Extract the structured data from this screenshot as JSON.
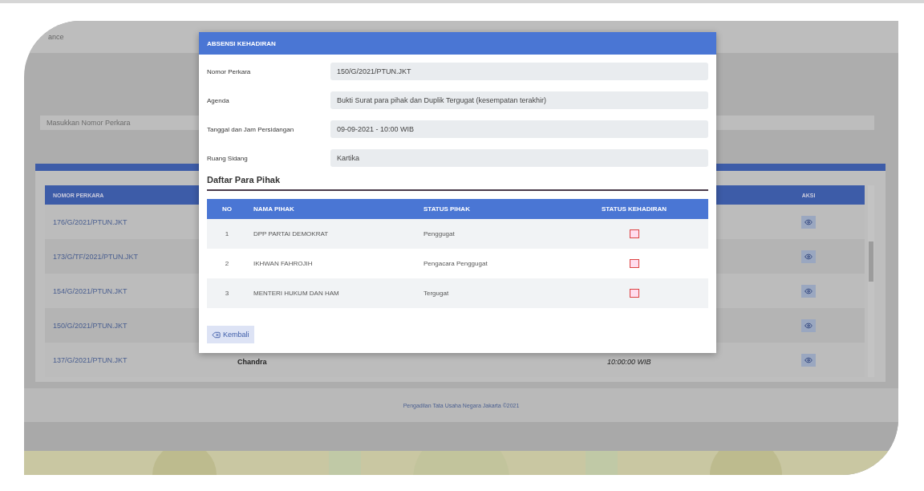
{
  "page": {
    "title_fragment": "ance",
    "search": {
      "placeholder": "Masukkan Nomor Perkara"
    },
    "table": {
      "columns": [
        "NOMOR PERKARA",
        "AKSI"
      ],
      "rows": [
        {
          "nomor": "176/G/2021/PTUN.JKT"
        },
        {
          "nomor": "173/G/TF/2021/PTUN.JKT"
        },
        {
          "nomor": "154/G/2021/PTUN.JKT"
        },
        {
          "nomor": "150/G/2021/PTUN.JKT"
        },
        {
          "nomor": "137/G/2021/PTUN.JKT",
          "column_2": "Chandra",
          "column_3": "10:00:00 WIB"
        }
      ]
    },
    "footer": "Pengadilan Tata Usaha Negara Jakarta ©2021"
  },
  "modal": {
    "title": "ABSENSI KEHADIRAN",
    "fields": [
      {
        "label": "Nomor Perkara",
        "value": "150/G/2021/PTUN.JKT"
      },
      {
        "label": "Agenda",
        "value": "Bukti Surat para pihak dan Duplik Tergugat (kesempatan terakhir)"
      },
      {
        "label": "Tanggal dan Jam Persidangan",
        "value": "09-09-2021 - 10:00 WIB"
      },
      {
        "label": "Ruang Sidang",
        "value": "Kartika"
      }
    ],
    "section_title": "Daftar Para Pihak",
    "table": {
      "columns": [
        "NO",
        "NAMA PIHAK",
        "STATUS PIHAK",
        "STATUS KEHADIRAN"
      ],
      "rows": [
        {
          "no": "1",
          "nama": "DPP PARTAI DEMOKRAT",
          "status": "Penggugat",
          "checked": false
        },
        {
          "no": "2",
          "nama": "IKHWAN FAHROJIH",
          "status": "Pengacara Penggugat",
          "checked": false
        },
        {
          "no": "3",
          "nama": "MENTERI HUKUM DAN HAM",
          "status": "Tergugat",
          "checked": false
        }
      ]
    },
    "back_button": "Kembali"
  }
}
